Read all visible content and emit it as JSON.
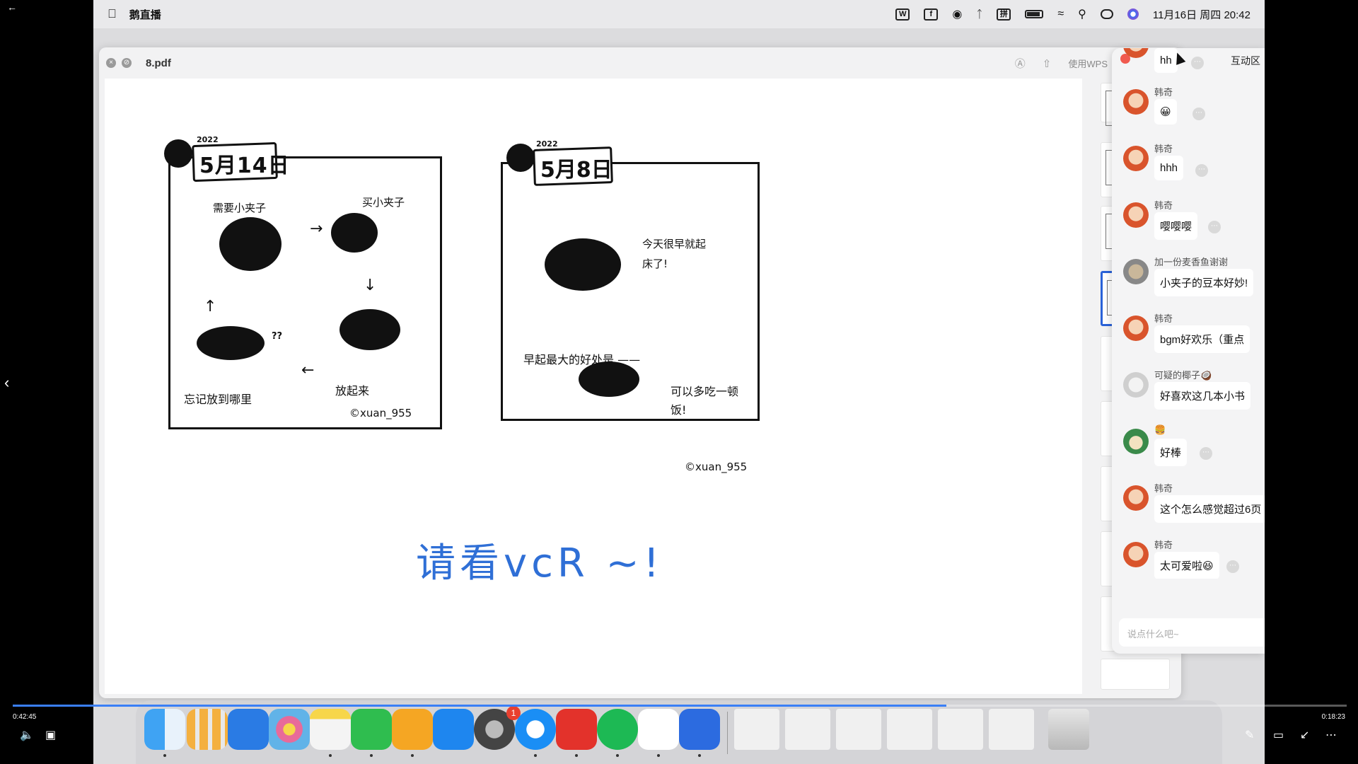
{
  "menubar": {
    "app_name": "鹅直播",
    "status_w": "W",
    "status_f": "f",
    "status_pinyin": "拼",
    "datetime": "11月16日 周四 20:42"
  },
  "pdf": {
    "filename": "8.pdf",
    "wps_label": "使用WPS",
    "comic_left": {
      "year": "2022",
      "date": "5月14日",
      "texts": [
        "需要小夹子",
        "买小夹子",
        "放起来",
        "忘记放到哪里"
      ],
      "q": "??",
      "credit": "©xuan_955"
    },
    "comic_right": {
      "year": "2022",
      "date": "5月8日",
      "texts": [
        "今天很早就起床了!",
        "早起最大的好处是 ——",
        "可以多吃一顿饭!"
      ],
      "credit": "©xuan_955"
    },
    "caption": "请看vcR ~!"
  },
  "chat": {
    "title": "互动区",
    "input_placeholder": "说点什么吧~",
    "messages": [
      {
        "user": "",
        "text": "hh",
        "avatar": "orange"
      },
      {
        "user": "韩奇",
        "text": "😀",
        "avatar": "orange"
      },
      {
        "user": "韩奇",
        "text": "hhh",
        "avatar": "orange"
      },
      {
        "user": "韩奇",
        "text": "嘤嘤嘤",
        "avatar": "orange"
      },
      {
        "user": "加一份麦香鱼谢谢",
        "text": "小夹子的豆本好妙!",
        "avatar": "gray"
      },
      {
        "user": "韩奇",
        "text": "bgm好欢乐（重点",
        "avatar": "orange"
      },
      {
        "user": "可疑的椰子🥥",
        "text": "好喜欢这几本小书",
        "avatar": "light"
      },
      {
        "user": "🍔",
        "text": "好棒",
        "avatar": "green"
      },
      {
        "user": "韩奇",
        "text": "这个怎么感觉超过6页",
        "avatar": "orange"
      },
      {
        "user": "韩奇",
        "text": "太可爱啦😆",
        "avatar": "orange"
      }
    ]
  },
  "dock": {
    "badge_settings": "1",
    "netease_left": "10",
    "spotify_left": "30"
  },
  "video": {
    "elapsed": "0:42:45",
    "remaining": "0:18:23",
    "progress": 0.7
  }
}
